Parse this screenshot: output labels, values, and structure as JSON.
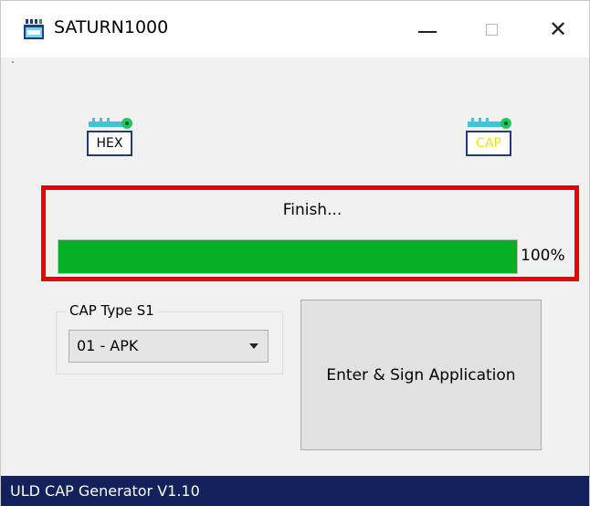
{
  "window": {
    "title": "SATURN1000",
    "icons": {
      "app": "app-chip-icon",
      "minimize": "minimize-icon",
      "maximize": "maximize-icon",
      "close": "close-icon"
    },
    "close_glyph": "✕"
  },
  "icons": {
    "hex": {
      "label": "HEX",
      "icon": "hex-chip-icon",
      "label_color": "#000000"
    },
    "cap": {
      "label": "CAP",
      "icon": "cap-chip-icon",
      "label_color": "#e8e800"
    }
  },
  "progress": {
    "status": "Finish...",
    "value": 100,
    "percent_label": "100%",
    "fill_color": "#06b025",
    "highlight_color": "#ee0000"
  },
  "cap_type": {
    "group_label": "CAP Type S1",
    "selected": "01 - APK"
  },
  "actions": {
    "enter_sign": "Enter & Sign Application"
  },
  "statusbar": {
    "text": "ULD CAP Generator V1.10",
    "color": "#13215c"
  }
}
